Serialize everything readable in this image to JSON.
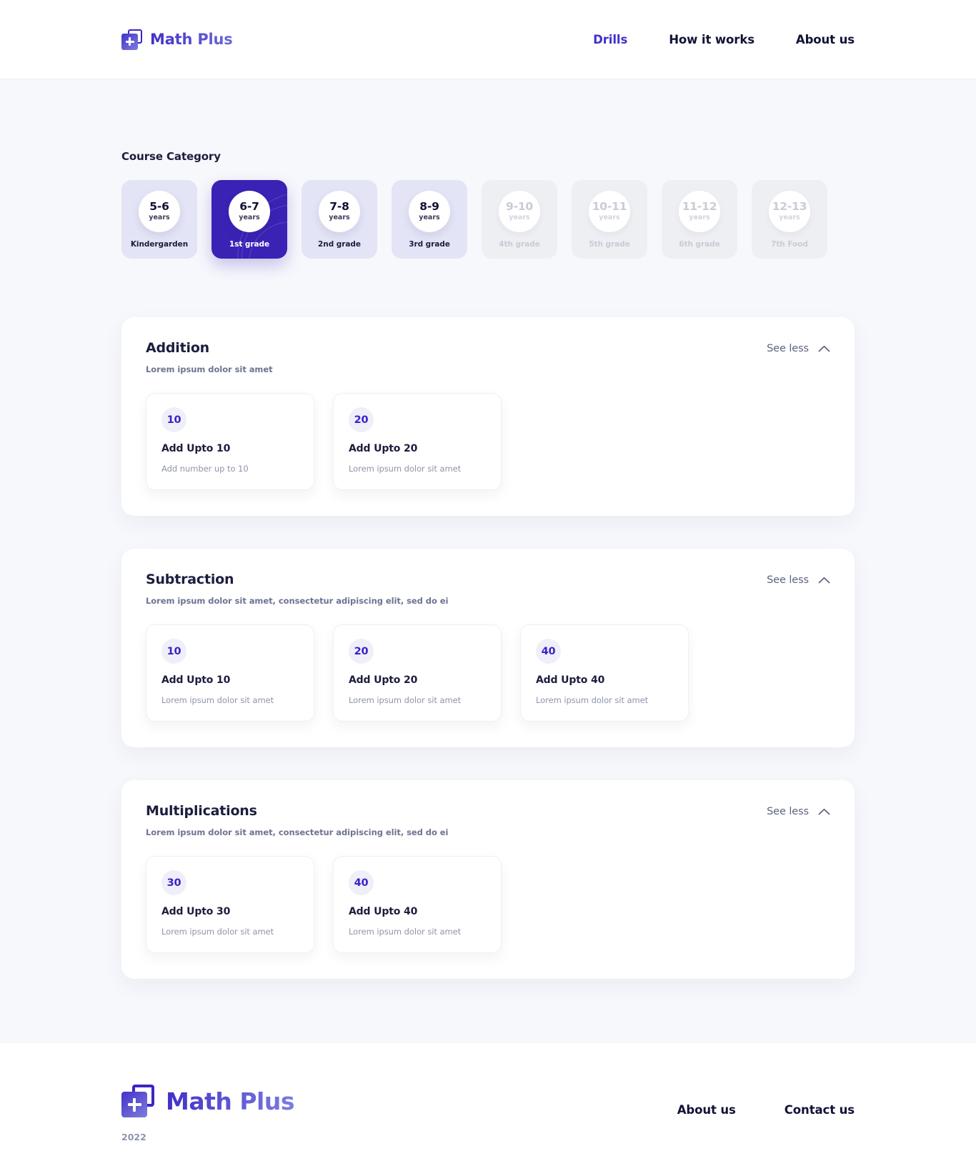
{
  "header": {
    "brand": "Math Plus",
    "logo_icon": "plus-square-icon",
    "nav": [
      {
        "label": "Drills",
        "active": true
      },
      {
        "label": "How it works",
        "active": false
      },
      {
        "label": "About us",
        "active": false
      }
    ]
  },
  "colors": {
    "accent": "#3a22b5",
    "accent_text": "#4030cc",
    "page_bg": "#f7f8fc",
    "card_bg": "#ffffff",
    "category_bg": "#e3e4f6",
    "category_disabled_bg": "#eeeff3",
    "badge_bg": "#eeeff8",
    "muted_text": "#8f94ad"
  },
  "category": {
    "label": "Course Category",
    "unit": "years",
    "items": [
      {
        "age": "5-6",
        "grade": "Kindergarden",
        "state": "enabled"
      },
      {
        "age": "6-7",
        "grade": "1st grade",
        "state": "active"
      },
      {
        "age": "7-8",
        "grade": "2nd grade",
        "state": "enabled"
      },
      {
        "age": "8-9",
        "grade": "3rd grade",
        "state": "enabled"
      },
      {
        "age": "9-10",
        "grade": "4th grade",
        "state": "disabled"
      },
      {
        "age": "10-11",
        "grade": "5th grade",
        "state": "disabled"
      },
      {
        "age": "11-12",
        "grade": "6th grade",
        "state": "disabled"
      },
      {
        "age": "12-13",
        "grade": "7th Food",
        "state": "disabled"
      }
    ]
  },
  "sections": [
    {
      "title": "Addition",
      "subtitle": "Lorem ipsum dolor sit amet",
      "toggle_label": "See less",
      "toggle_icon": "chevron-up-icon",
      "drills": [
        {
          "number": "10",
          "name": "Add Upto 10",
          "desc": "Add number up to 10"
        },
        {
          "number": "20",
          "name": "Add Upto 20",
          "desc": "Lorem ipsum dolor sit amet"
        }
      ]
    },
    {
      "title": "Subtraction",
      "subtitle": "Lorem ipsum dolor sit amet, consectetur adipiscing elit, sed do ei",
      "toggle_label": "See less",
      "toggle_icon": "chevron-up-icon",
      "drills": [
        {
          "number": "10",
          "name": "Add Upto 10",
          "desc": "Lorem ipsum dolor sit amet"
        },
        {
          "number": "20",
          "name": "Add Upto 20",
          "desc": "Lorem ipsum dolor sit amet"
        },
        {
          "number": "40",
          "name": "Add Upto 40",
          "desc": "Lorem ipsum dolor sit amet"
        }
      ]
    },
    {
      "title": "Multiplications",
      "subtitle": "Lorem ipsum dolor sit amet, consectetur adipiscing elit, sed do ei",
      "toggle_label": "See less",
      "toggle_icon": "chevron-up-icon",
      "drills": [
        {
          "number": "30",
          "name": "Add Upto 30",
          "desc": "Lorem ipsum dolor sit amet"
        },
        {
          "number": "40",
          "name": "Add Upto 40",
          "desc": "Lorem ipsum dolor sit amet"
        }
      ]
    }
  ],
  "footer": {
    "brand": "Math Plus",
    "logo_icon": "plus-square-icon",
    "year": "2022",
    "links": [
      {
        "label": "About us"
      },
      {
        "label": "Contact us"
      }
    ]
  }
}
